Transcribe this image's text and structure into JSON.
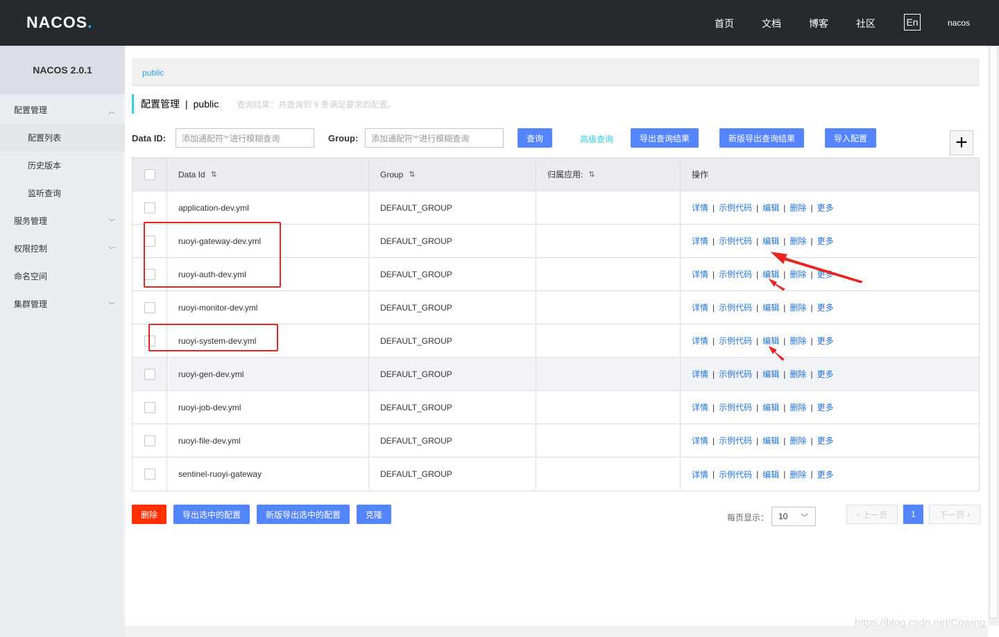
{
  "header": {
    "logo_text": "NACOS",
    "logo_dot": ".",
    "nav": [
      "首页",
      "文档",
      "博客",
      "社区"
    ],
    "lang": "En",
    "user": "nacos"
  },
  "sidebar": {
    "title": "NACOS 2.0.1",
    "items": [
      {
        "label": "配置管理",
        "type": "top",
        "expanded": true
      },
      {
        "label": "配置列表",
        "type": "sub",
        "active": true
      },
      {
        "label": "历史版本",
        "type": "sub"
      },
      {
        "label": "监听查询",
        "type": "sub"
      },
      {
        "label": "服务管理",
        "type": "top"
      },
      {
        "label": "权限控制",
        "type": "top"
      },
      {
        "label": "命名空间",
        "type": "top"
      },
      {
        "label": "集群管理",
        "type": "top"
      }
    ]
  },
  "main": {
    "namespace_tab": "public",
    "title": "配置管理",
    "title_sep": "|",
    "title_ns": "public",
    "result_hint": "查询结果：共查询到 9 条满足要求的配置。",
    "filter": {
      "dataid_label": "Data ID:",
      "dataid_placeholder": "添加通配符'*'进行模糊查询",
      "group_label": "Group:",
      "group_placeholder": "添加通配符'*'进行模糊查询",
      "query_btn": "查询",
      "advanced_link": "高级查询",
      "export_btn": "导出查询结果",
      "export_new_btn": "新版导出查询结果",
      "import_btn": "导入配置",
      "add_btn": "+"
    },
    "table": {
      "headers": [
        "Data Id",
        "Group",
        "归属应用:",
        "操作"
      ],
      "sort_glyph": "⇅",
      "ops": [
        "详情",
        "示例代码",
        "编辑",
        "删除",
        "更多"
      ],
      "op_sep": "|",
      "rows": [
        {
          "data_id": "application-dev.yml",
          "group": "DEFAULT_GROUP",
          "app": ""
        },
        {
          "data_id": "ruoyi-gateway-dev.yml",
          "group": "DEFAULT_GROUP",
          "app": ""
        },
        {
          "data_id": "ruoyi-auth-dev.yml",
          "group": "DEFAULT_GROUP",
          "app": ""
        },
        {
          "data_id": "ruoyi-monitor-dev.yml",
          "group": "DEFAULT_GROUP",
          "app": ""
        },
        {
          "data_id": "ruoyi-system-dev.yml",
          "group": "DEFAULT_GROUP",
          "app": ""
        },
        {
          "data_id": "ruoyi-gen-dev.yml",
          "group": "DEFAULT_GROUP",
          "app": ""
        },
        {
          "data_id": "ruoyi-job-dev.yml",
          "group": "DEFAULT_GROUP",
          "app": ""
        },
        {
          "data_id": "ruoyi-file-dev.yml",
          "group": "DEFAULT_GROUP",
          "app": ""
        },
        {
          "data_id": "sentinel-ruoyi-gateway",
          "group": "DEFAULT_GROUP",
          "app": ""
        }
      ]
    },
    "footer": {
      "delete_btn": "删除",
      "export_selected_btn": "导出选中的配置",
      "export_selected_new_btn": "新版导出选中的配置",
      "clone_btn": "克隆",
      "page_size_label": "每页显示：",
      "page_size": "10",
      "prev": "上一页",
      "next": "下一页",
      "page": "1"
    }
  },
  "watermark": "https://blog.csdn.net/Cowing",
  "colors": {
    "primary": "#5584ff",
    "danger": "#ff3000",
    "annotation": "#e8241f",
    "header_bg": "#252a2f"
  }
}
